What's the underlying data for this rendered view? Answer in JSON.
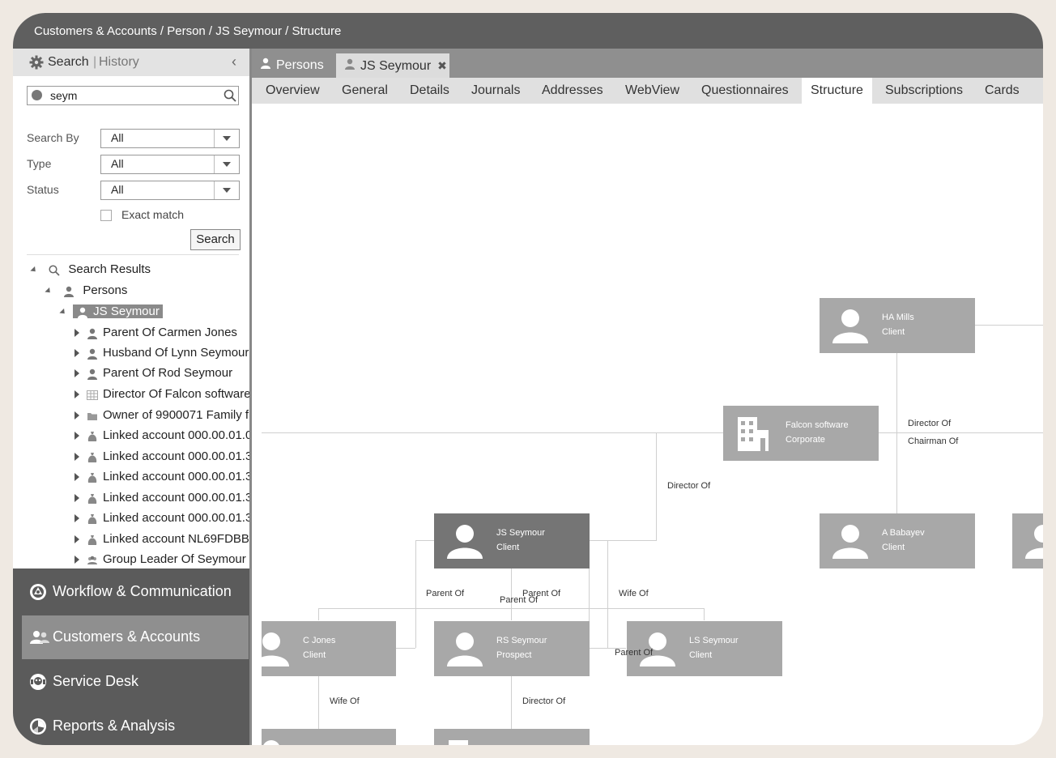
{
  "breadcrumb": "Customers & Accounts / Person / JS Seymour / Structure",
  "sidebar": {
    "search_tab": "Search",
    "separator": "|",
    "history_tab": "History",
    "search_value": "seym",
    "search_by_label": "Search By",
    "search_by_value": "All",
    "type_label": "Type",
    "type_value": "All",
    "status_label": "Status",
    "status_value": "All",
    "exact_match_label": "Exact match",
    "search_button": "Search",
    "tree": {
      "root": "Search Results",
      "persons": "Persons",
      "selected": "JS Seymour",
      "children": [
        {
          "label": "Parent Of Carmen Jones",
          "icon": "person-icon"
        },
        {
          "label": "Husband Of Lynn Seymour",
          "icon": "person-icon"
        },
        {
          "label": "Parent Of Rod Seymour",
          "icon": "person-icon"
        },
        {
          "label": "Director Of Falcon software",
          "icon": "building-icon"
        },
        {
          "label": "Owner of 9900071 Family f",
          "icon": "folder-icon"
        },
        {
          "label": "Linked account 000.00.01.0",
          "icon": "money-bag-icon"
        },
        {
          "label": "Linked account 000.00.01.3",
          "icon": "money-bag-icon"
        },
        {
          "label": "Linked account 000.00.01.3",
          "icon": "money-bag-icon"
        },
        {
          "label": "Linked account 000.00.01.3",
          "icon": "money-bag-icon"
        },
        {
          "label": "Linked account 000.00.01.3",
          "icon": "money-bag-icon"
        },
        {
          "label": "Linked account NL69FDBB",
          "icon": "money-bag-icon"
        },
        {
          "label": "Group Leader Of Seymour",
          "icon": "group-icon"
        }
      ]
    },
    "nav": [
      {
        "label": "Workflow & Communication",
        "icon": "workflow-icon"
      },
      {
        "label": "Customers & Accounts",
        "icon": "customers-icon"
      },
      {
        "label": "Service Desk",
        "icon": "service-desk-icon"
      },
      {
        "label": "Reports & Analysis",
        "icon": "reports-icon"
      }
    ]
  },
  "tabs": [
    {
      "label": "Persons"
    },
    {
      "label": "JS Seymour",
      "close": "✖"
    }
  ],
  "subtabs": [
    "Overview",
    "General",
    "Details",
    "Journals",
    "Addresses",
    "WebView",
    "Questionnaires",
    "Structure",
    "Subscriptions",
    "Cards"
  ],
  "structure": {
    "cards": [
      {
        "name": "HA Mills",
        "type": "Client"
      },
      {
        "name": "Falcon software",
        "type": "Corporate"
      },
      {
        "name": "JS Seymour",
        "type": "Client"
      },
      {
        "name": "A Babayev",
        "type": "Client"
      },
      {
        "name": "C Jones",
        "type": "Client"
      },
      {
        "name": "RS Seymour",
        "type": "Prospect"
      },
      {
        "name": "LS Seymour",
        "type": "Client"
      }
    ],
    "relations": {
      "director_of_1": "Director Of",
      "chairman_of": "Chairman Of",
      "director_of_2": "Director Of",
      "parent_of_1": "Parent Of",
      "parent_of_2": "Parent Of",
      "parent_of_3": "Parent Of",
      "wife_of_1": "Wife Of",
      "parent_of_4": "Parent Of",
      "wife_of_2": "Wife Of",
      "director_of_3": "Director Of"
    }
  },
  "colors": {
    "topbar": "#5f5f5f",
    "nav": "#5b5b5b",
    "nav_active": "#8f8f8f",
    "card": "#a8a8a8",
    "card_selected": "#757575"
  }
}
